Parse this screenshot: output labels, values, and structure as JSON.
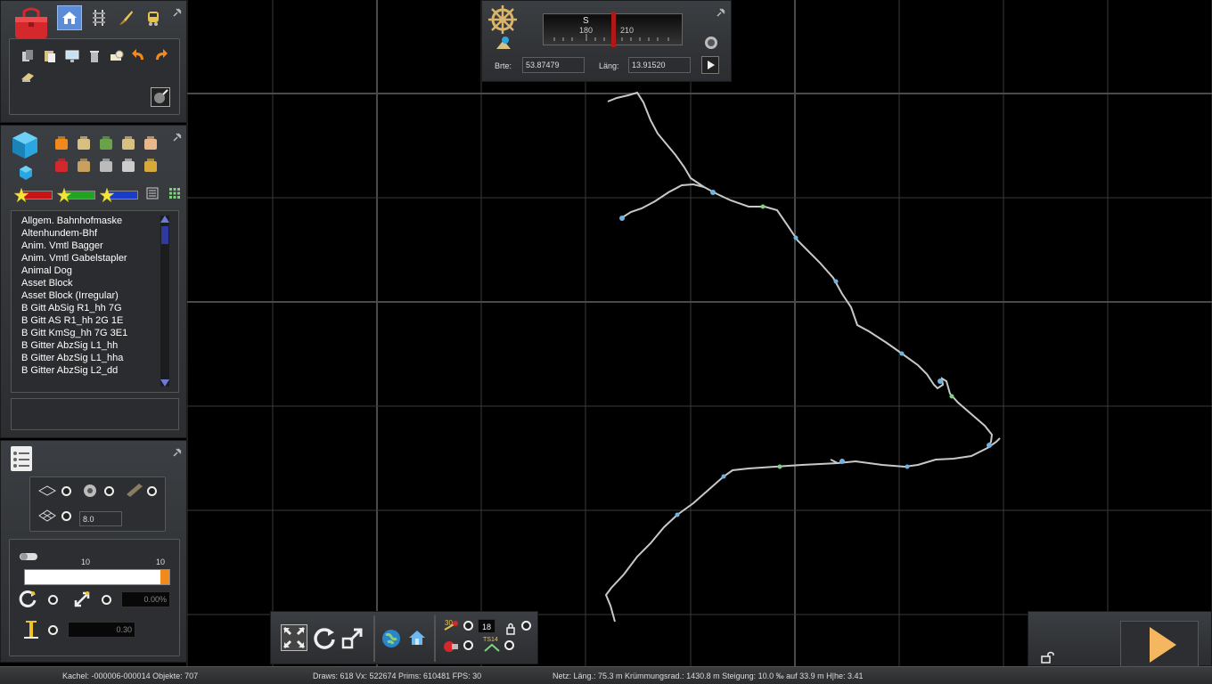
{
  "toolbox": {
    "tabs": [
      {
        "icon": "toolbox-icon"
      },
      {
        "icon": "house-icon"
      },
      {
        "icon": "track-icon"
      },
      {
        "icon": "brush-icon"
      },
      {
        "icon": "train-icon"
      }
    ],
    "tools": [
      "copy-icon",
      "paste-icon",
      "monitor-icon",
      "trash-icon",
      "tape-icon",
      "undo-icon",
      "redo-icon",
      "move-icon"
    ]
  },
  "object_panel": {
    "categories": [
      "house-icon",
      "bench-icon",
      "tree-icon",
      "track-pieces-icon",
      "face-icon",
      "signal-icon",
      "planks-icon",
      "bridge-icon",
      "speaker-icon",
      "bag-icon"
    ],
    "filters": [
      {
        "color": "#c81414"
      },
      {
        "color": "#22a422"
      },
      {
        "color": "#1a3cc8"
      }
    ],
    "items": [
      "Allgem. Bahnhofmaske",
      "Altenhundem-Bhf",
      "Anim. Vmtl Bagger",
      "Anim. Vmtl Gabelstapler",
      "Animal Dog",
      "Asset Block",
      "Asset Block (Irregular)",
      "B Gitt AbSig R1_hh 7G",
      "B Gitt AS R1_hh 2G 1E",
      "B Gitt KmSg_hh 7G 3E1",
      "B Gitter AbzSig L1_hh",
      "B Gitter AbzSig L1_hha",
      "B Gitter AbzSig L2_dd"
    ]
  },
  "options_panel": {
    "grid_value": "8.0",
    "slider_min_label": "10",
    "slider_max_label": "10",
    "slider_level": 1.0,
    "rotation_value": "0.00%",
    "height_value": "0.30"
  },
  "compass": {
    "direction_letter": "S",
    "tick_left": "180",
    "tick_right": "210",
    "lat_label": "Brte:",
    "lat_value": "53.87479",
    "lon_label": "Läng:",
    "lon_value": "13.91520"
  },
  "bottom_toolbar": {
    "speed_value": "18",
    "label_30": "30",
    "label_ts14": "TS14"
  },
  "status": {
    "tile": "Kachel: -000006-000014  Objekte: 707",
    "render": "Draws: 618 Vx: 522674 Prims: 610481 FPS: 30",
    "net": "Netz:  Läng.:   75.3 m Krümmungsrad.: 1430.8 m Steigung: 10.0 ‰ auf 33.9 m H|he:   3.41"
  },
  "colors": {
    "track": "#c8c8c8",
    "grid": "#3a3a3a",
    "accent_orange": "#f08a1c",
    "panel": "#35373a"
  }
}
